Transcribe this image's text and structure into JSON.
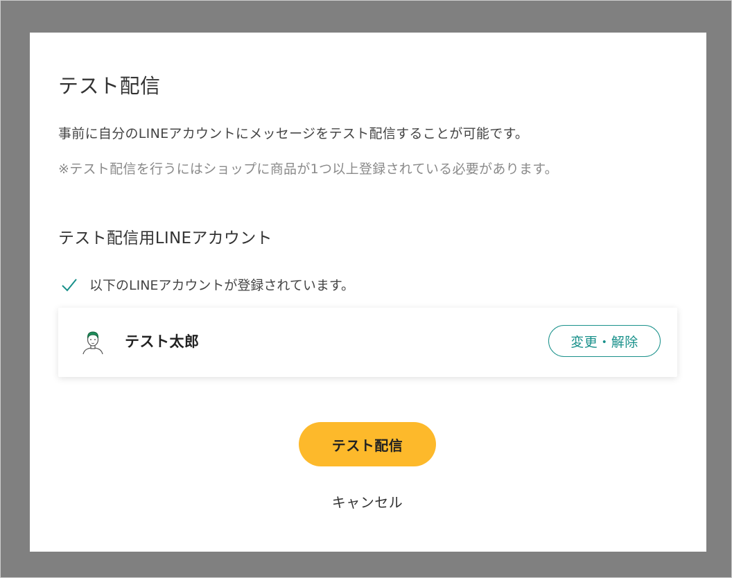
{
  "dialog": {
    "title": "テスト配信",
    "description": "事前に自分のLINEアカウントにメッセージをテスト配信することが可能です。",
    "note": "※テスト配信を行うにはショップに商品が1つ以上登録されている必要があります。"
  },
  "section": {
    "title": "テスト配信用LINEアカウント",
    "status_text": "以下のLINEアカウントが登録されています。",
    "status_icon": "check-icon"
  },
  "account": {
    "name": "テスト太郎",
    "avatar_icon": "user-avatar-icon",
    "change_label": "変更・解除"
  },
  "actions": {
    "send_label": "テスト配信",
    "cancel_label": "キャンセル"
  },
  "colors": {
    "overlay": "#808080",
    "accent_teal": "#18908a",
    "primary_yellow": "#fdb92b"
  }
}
